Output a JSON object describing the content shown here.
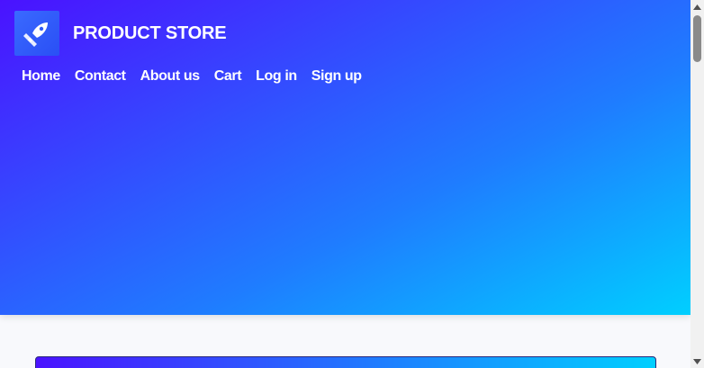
{
  "brand": {
    "name": "PRODUCT STORE",
    "logo_icon": "rocket-icon"
  },
  "nav": {
    "items": [
      {
        "label": "Home"
      },
      {
        "label": "Contact"
      },
      {
        "label": "About us"
      },
      {
        "label": "Cart"
      },
      {
        "label": "Log in"
      },
      {
        "label": "Sign up"
      }
    ]
  },
  "colors": {
    "gradient_start": "#4a12ff",
    "gradient_end": "#00cfff",
    "page_background": "#f8f9fc"
  },
  "scrollbar": {
    "up_icon": "scroll-up-arrow-icon",
    "down_icon": "scroll-down-arrow-icon"
  }
}
